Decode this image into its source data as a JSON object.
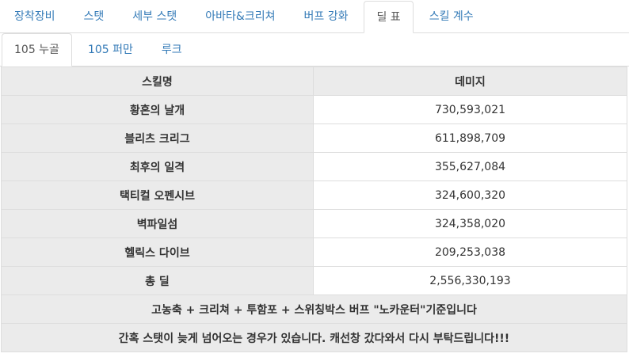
{
  "main_tabs": [
    {
      "label": "장착장비",
      "active": false
    },
    {
      "label": "스탯",
      "active": false
    },
    {
      "label": "세부 스탯",
      "active": false
    },
    {
      "label": "아바타&크리쳐",
      "active": false
    },
    {
      "label": "버프 강화",
      "active": false
    },
    {
      "label": "딜 표",
      "active": true
    },
    {
      "label": "스킬 계수",
      "active": false
    }
  ],
  "sub_tabs": [
    {
      "label": "105 누골",
      "active": true
    },
    {
      "label": "105 퍼만",
      "active": false
    },
    {
      "label": "루크",
      "active": false
    }
  ],
  "table": {
    "headers": [
      "스킬명",
      "데미지"
    ],
    "rows": [
      {
        "skill": "황혼의 날개",
        "damage": "730,593,021"
      },
      {
        "skill": "블리츠 크리그",
        "damage": "611,898,709"
      },
      {
        "skill": "최후의 일격",
        "damage": "355,627,084"
      },
      {
        "skill": "택티컬 오펜시브",
        "damage": "324,600,320"
      },
      {
        "skill": "벽파일섬",
        "damage": "324,358,020"
      },
      {
        "skill": "헬릭스 다이브",
        "damage": "209,253,038"
      },
      {
        "skill": "총 딜",
        "damage": "2,556,330,193"
      }
    ],
    "notes": [
      "고농축 + 크리쳐 + 투함포 + 스위칭박스 버프 \"노카운터\"기준입니다",
      "간혹 스탯이 늦게 넘어오는 경우가 있습니다. 캐선창 갔다와서 다시 부탁드립니다!!!"
    ]
  },
  "colors": {
    "link": "#337ab7",
    "header_bg": "#ebebeb",
    "border": "#dddddd"
  }
}
